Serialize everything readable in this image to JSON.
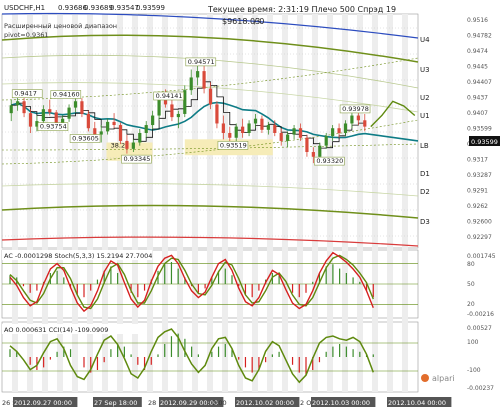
{
  "header": {
    "symbol_tf": "USDCHF,H1",
    "ohlc": [
      "0.93686",
      "0.93689",
      "0.93547",
      "0.93599"
    ],
    "subtitle_1": "Расширенный ценовой диапазон",
    "subtitle_2": "pivot=0.9361",
    "status": "Текущее время: 2:31:19 Плечо 500 Спрэд 19",
    "balance": "$9618.03",
    "counter": "/ 0"
  },
  "brand": "alpari",
  "colors": {
    "background": "#ffffff",
    "grid": "#c8c8c8",
    "band_blue": "#2c4cbf",
    "band_olive": "#6f8f1a",
    "band_red": "#d93b3b",
    "candle_bull": "#3c8c2c",
    "candle_bear": "#d94a3b",
    "ma_black": "#111111",
    "ma_teal": "#0e7c86",
    "price_badge": "#111111",
    "highlight": "#f6ecb8",
    "osc_red": "#d62020",
    "osc_olive": "#5f8a0f",
    "text": "#333333"
  },
  "chart_data": [
    {
      "type": "candlestick",
      "name": "main",
      "ylim": [
        0.9225,
        0.952
      ],
      "y_ticks": [
        "0.9516",
        "0.94782",
        "0.9474",
        "0.9445",
        "0.94407",
        "0.9437",
        "0.9407",
        "0.93599",
        "0.9337",
        "0.9317",
        "0.93287",
        "0.9291",
        "0.9262",
        "0.92600",
        "0.92297"
      ],
      "current_price": "0.93599",
      "candles": [
        [
          0.9395,
          0.9412,
          0.9385,
          0.9405
        ],
        [
          0.9405,
          0.942,
          0.9398,
          0.941
        ],
        [
          0.941,
          0.9416,
          0.939,
          0.9395
        ],
        [
          0.9395,
          0.94,
          0.937,
          0.9378
        ],
        [
          0.9378,
          0.9392,
          0.9372,
          0.9385
        ],
        [
          0.9385,
          0.9405,
          0.938,
          0.94
        ],
        [
          0.94,
          0.9412,
          0.9392,
          0.9396
        ],
        [
          0.9396,
          0.9399,
          0.9375,
          0.938
        ],
        [
          0.938,
          0.9392,
          0.9374,
          0.9388
        ],
        [
          0.9388,
          0.9406,
          0.9384,
          0.9402
        ],
        [
          0.9402,
          0.9416,
          0.9396,
          0.941
        ],
        [
          0.941,
          0.9414,
          0.939,
          0.9394
        ],
        [
          0.9394,
          0.9398,
          0.9372,
          0.9376
        ],
        [
          0.9376,
          0.9384,
          0.9362,
          0.9368
        ],
        [
          0.9368,
          0.938,
          0.9358,
          0.9372
        ],
        [
          0.9372,
          0.9388,
          0.9368,
          0.9384
        ],
        [
          0.9384,
          0.9395,
          0.9376,
          0.938
        ],
        [
          0.938,
          0.9383,
          0.9356,
          0.936
        ],
        [
          0.936,
          0.9368,
          0.9344,
          0.935
        ],
        [
          0.935,
          0.9362,
          0.9346,
          0.9358
        ],
        [
          0.9358,
          0.9375,
          0.9354,
          0.937
        ],
        [
          0.937,
          0.9385,
          0.9364,
          0.938
        ],
        [
          0.938,
          0.9398,
          0.9375,
          0.9392
        ],
        [
          0.9392,
          0.9418,
          0.9386,
          0.9412
        ],
        [
          0.9412,
          0.9425,
          0.9402,
          0.9406
        ],
        [
          0.9406,
          0.9412,
          0.9385,
          0.939
        ],
        [
          0.939,
          0.9398,
          0.9376,
          0.9394
        ],
        [
          0.9394,
          0.943,
          0.939,
          0.9424
        ],
        [
          0.9424,
          0.945,
          0.9418,
          0.944
        ],
        [
          0.944,
          0.9458,
          0.943,
          0.9448
        ],
        [
          0.9448,
          0.9455,
          0.942,
          0.9426
        ],
        [
          0.9426,
          0.9434,
          0.94,
          0.9406
        ],
        [
          0.9406,
          0.941,
          0.9376,
          0.9382
        ],
        [
          0.9382,
          0.9392,
          0.9362,
          0.937
        ],
        [
          0.937,
          0.9378,
          0.9352,
          0.9364
        ],
        [
          0.9364,
          0.9382,
          0.9358,
          0.9378
        ],
        [
          0.9378,
          0.9388,
          0.9364,
          0.937
        ],
        [
          0.937,
          0.9386,
          0.9366,
          0.9382
        ],
        [
          0.9382,
          0.9394,
          0.9376,
          0.9388
        ],
        [
          0.9388,
          0.9392,
          0.937,
          0.9374
        ],
        [
          0.9374,
          0.9384,
          0.9368,
          0.938
        ],
        [
          0.938,
          0.9386,
          0.9366,
          0.937
        ],
        [
          0.937,
          0.9376,
          0.9354,
          0.936
        ],
        [
          0.936,
          0.9372,
          0.9352,
          0.9368
        ],
        [
          0.9368,
          0.938,
          0.9362,
          0.9376
        ],
        [
          0.9376,
          0.9382,
          0.936,
          0.9364
        ],
        [
          0.9364,
          0.9368,
          0.934,
          0.9346
        ],
        [
          0.9346,
          0.9352,
          0.9332,
          0.934
        ],
        [
          0.934,
          0.9358,
          0.9336,
          0.9354
        ],
        [
          0.9354,
          0.937,
          0.935,
          0.9366
        ],
        [
          0.9366,
          0.938,
          0.936,
          0.9376
        ],
        [
          0.9376,
          0.9382,
          0.9364,
          0.937
        ],
        [
          0.937,
          0.9386,
          0.9366,
          0.9382
        ],
        [
          0.9382,
          0.9398,
          0.9376,
          0.9392
        ],
        [
          0.9392,
          0.94,
          0.938,
          0.9386
        ],
        [
          0.9386,
          0.9394,
          0.9372,
          0.9378
        ]
      ],
      "price_labels": [
        {
          "text": "0.9417",
          "x": 0,
          "y": 0.9417
        },
        {
          "text": "0.94160",
          "x": 6,
          "y": 0.9416
        },
        {
          "text": "0.93754",
          "x": 4,
          "y": 0.93754
        },
        {
          "text": "0.93605",
          "x": 9,
          "y": 0.93605
        },
        {
          "text": "38.2",
          "x": 15,
          "y": 0.9352
        },
        {
          "text": "0.93345",
          "x": 17,
          "y": 0.93345
        },
        {
          "text": "0.94141",
          "x": 22,
          "y": 0.94141
        },
        {
          "text": "0.94571",
          "x": 27,
          "y": 0.94571
        },
        {
          "text": "0.93519",
          "x": 32,
          "y": 0.93519
        },
        {
          "text": "0.93320",
          "x": 47,
          "y": 0.9332
        },
        {
          "text": "0.93978",
          "x": 51,
          "y": 0.93978
        }
      ],
      "level_labels": [
        "U4",
        "U3",
        "U2",
        "U1",
        "LB",
        "D1",
        "D2",
        "D3"
      ],
      "projection": [
        0.9378,
        0.9392,
        0.941,
        0.9404,
        0.9392
      ]
    },
    {
      "type": "line",
      "name": "AC / Stochastic",
      "label": "AC -0.0001298  Stoch(5,3,3) 15.2194 27.7004",
      "ylim": [
        0,
        100
      ],
      "levels": [
        80,
        50,
        20
      ],
      "y_ticks": [
        "0.001745",
        "80",
        "50",
        "20",
        "-0.00216"
      ],
      "series": [
        {
          "name": "stoch_main",
          "values": [
            60,
            48,
            30,
            18,
            24,
            50,
            72,
            80,
            70,
            45,
            22,
            10,
            18,
            40,
            68,
            84,
            78,
            52,
            28,
            16,
            26,
            54,
            76,
            88,
            92,
            80,
            58,
            40,
            30,
            38,
            60,
            80,
            86,
            70,
            44,
            24,
            18,
            30,
            52,
            70,
            64,
            42,
            22,
            14,
            20,
            40,
            66,
            84,
            96,
            90,
            82,
            72,
            60,
            40,
            15
          ]
        },
        {
          "name": "stoch_signal",
          "values": [
            64,
            55,
            40,
            26,
            22,
            36,
            58,
            74,
            74,
            58,
            34,
            16,
            14,
            28,
            52,
            74,
            80,
            64,
            40,
            22,
            22,
            40,
            62,
            80,
            88,
            86,
            70,
            50,
            36,
            34,
            48,
            68,
            82,
            78,
            58,
            34,
            22,
            24,
            40,
            60,
            66,
            54,
            34,
            20,
            18,
            30,
            52,
            74,
            88,
            92,
            86,
            78,
            66,
            52,
            28
          ]
        },
        {
          "name": "ac_histogram",
          "values": [
            0.4,
            0.3,
            -0.1,
            -0.4,
            -0.3,
            0.1,
            0.5,
            0.6,
            0.3,
            -0.2,
            -0.5,
            -0.6,
            -0.3,
            0.2,
            0.6,
            0.8,
            0.5,
            0.0,
            -0.4,
            -0.6,
            -0.3,
            0.2,
            0.6,
            0.9,
            1.0,
            0.7,
            0.3,
            -0.1,
            -0.4,
            -0.2,
            0.3,
            0.6,
            0.7,
            0.4,
            -0.1,
            -0.5,
            -0.6,
            -0.3,
            0.2,
            0.5,
            0.4,
            0.0,
            -0.4,
            -0.6,
            -0.4,
            0.1,
            0.5,
            0.8,
            0.9,
            0.7,
            0.5,
            0.3,
            0.1,
            -0.3,
            -0.6
          ]
        }
      ]
    },
    {
      "type": "line",
      "name": "AO / CCI",
      "label": "AO 0.000631  CCI(14) -109.0909",
      "ylim": [
        -250,
        250
      ],
      "levels": [
        100,
        -100
      ],
      "y_ticks": [
        "0.00527",
        "100",
        "-100",
        "-0.00237"
      ],
      "series": [
        {
          "name": "cci",
          "values": [
            80,
            40,
            -20,
            -90,
            -60,
            30,
            110,
            130,
            60,
            -60,
            -140,
            -160,
            -90,
            20,
            120,
            150,
            90,
            -10,
            -120,
            -150,
            -80,
            40,
            140,
            180,
            200,
            140,
            40,
            -50,
            -110,
            -60,
            60,
            130,
            140,
            60,
            -60,
            -150,
            -170,
            -90,
            40,
            110,
            80,
            -20,
            -120,
            -180,
            -130,
            -10,
            100,
            140,
            150,
            130,
            120,
            140,
            110,
            20,
            -109
          ]
        },
        {
          "name": "ao_histogram",
          "values": [
            0.3,
            0.2,
            0.0,
            -0.3,
            -0.5,
            -0.4,
            -0.1,
            0.2,
            0.4,
            0.3,
            0.0,
            -0.4,
            -0.6,
            -0.5,
            -0.2,
            0.3,
            0.5,
            0.4,
            0.1,
            -0.3,
            -0.5,
            -0.3,
            0.1,
            0.5,
            0.8,
            0.9,
            0.7,
            0.4,
            0.1,
            0.0,
            0.2,
            0.4,
            0.5,
            0.3,
            -0.1,
            -0.4,
            -0.6,
            -0.5,
            -0.2,
            0.1,
            0.2,
            0.0,
            -0.3,
            -0.6,
            -0.7,
            -0.5,
            -0.2,
            0.2,
            0.4,
            0.5,
            0.4,
            0.3,
            0.2,
            0.1,
            0.1
          ]
        }
      ]
    }
  ],
  "x_axis": {
    "labels": [
      "26 S",
      "2012.09.27 00:00",
      "27 Sep 18:00",
      "28",
      "2012.09.29 00:00",
      "2:00",
      "2012.10.02 00:00",
      "2 O",
      "2012.10.03 00:00",
      "2012.10.04 00:00"
    ]
  }
}
